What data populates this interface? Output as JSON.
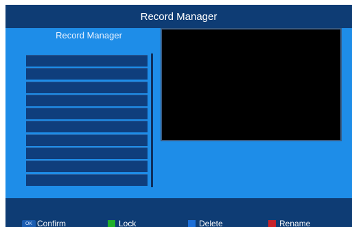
{
  "window": {
    "title": "Record Manager"
  },
  "panel": {
    "title": "Record Manager"
  },
  "records": [
    "",
    "",
    "",
    "",
    "",
    "",
    "",
    "",
    "",
    ""
  ],
  "footer": {
    "confirm": {
      "key": "OK",
      "label": "Confirm"
    },
    "lock": {
      "label": "Lock",
      "color": "#22b02a"
    },
    "delete": {
      "label": "Delete",
      "color": "#1c6fd8"
    },
    "rename": {
      "label": "Rename",
      "color": "#c8232a"
    }
  },
  "colors": {
    "frame": "#0e3c74",
    "panel": "#1e8de8",
    "row": "#0f3e7c",
    "preview": "#000000"
  }
}
